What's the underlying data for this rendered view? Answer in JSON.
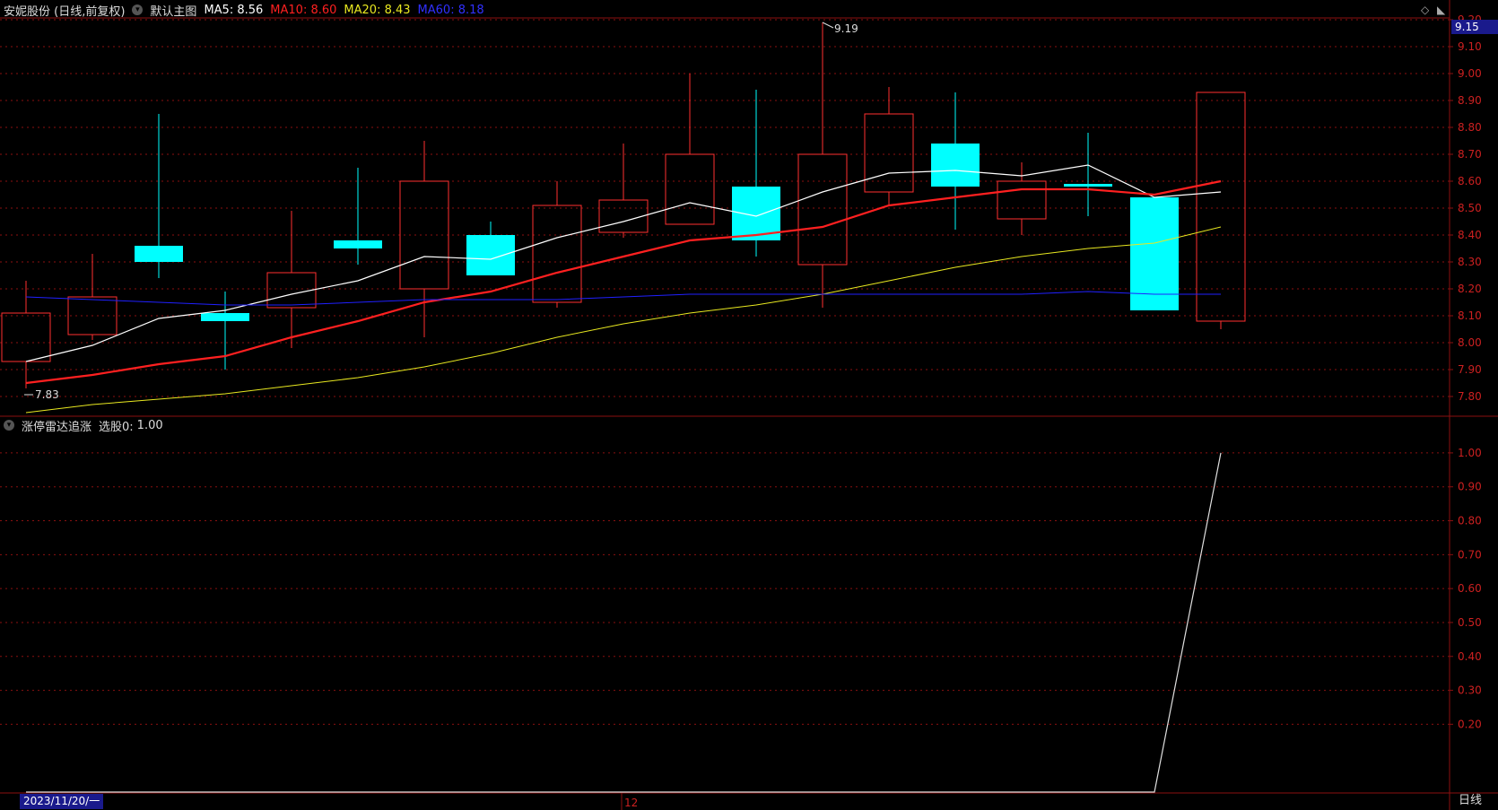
{
  "header": {
    "stock": "安妮股份 (日线,前复权)",
    "template_label": "默认主图",
    "ma5": {
      "label": "MA5:",
      "value": "8.56",
      "color": "#ffffff"
    },
    "ma10": {
      "label": "MA10:",
      "value": "8.60",
      "color": "#ff2020"
    },
    "ma20": {
      "label": "MA20:",
      "value": "8.43",
      "color": "#e8e820"
    },
    "ma60": {
      "label": "MA60:",
      "value": "8.18",
      "color": "#2020ff"
    }
  },
  "indicator_header": {
    "name": "涨停雷达追涨",
    "label": "选股0:",
    "value": "1.00"
  },
  "price_tag": "9.15",
  "axis_date": "2023/11/20/一",
  "month_label": "12",
  "timeframe": "日线",
  "annotations": {
    "high": "9.19",
    "low": "7.83"
  },
  "chart_data": [
    {
      "type": "candlestick",
      "colors": {
        "up": "#ff3030",
        "down": "#00ffff"
      },
      "ylim": [
        7.73,
        9.2
      ],
      "y_ticks": [
        "7.80",
        "7.90",
        "8.00",
        "8.10",
        "8.20",
        "8.30",
        "8.40",
        "8.50",
        "8.60",
        "8.70",
        "8.80",
        "8.90",
        "9.00",
        "9.10",
        "9.20"
      ],
      "candles": [
        {
          "o": 7.93,
          "h": 8.23,
          "l": 7.83,
          "c": 8.11
        },
        {
          "o": 8.03,
          "h": 8.33,
          "l": 8.01,
          "c": 8.17
        },
        {
          "o": 8.36,
          "h": 8.85,
          "l": 8.24,
          "c": 8.3
        },
        {
          "o": 8.11,
          "h": 8.19,
          "l": 7.9,
          "c": 8.08
        },
        {
          "o": 8.13,
          "h": 8.49,
          "l": 7.98,
          "c": 8.26
        },
        {
          "o": 8.38,
          "h": 8.65,
          "l": 8.29,
          "c": 8.35
        },
        {
          "o": 8.2,
          "h": 8.75,
          "l": 8.02,
          "c": 8.6
        },
        {
          "o": 8.4,
          "h": 8.45,
          "l": 8.25,
          "c": 8.25
        },
        {
          "o": 8.15,
          "h": 8.6,
          "l": 8.13,
          "c": 8.51
        },
        {
          "o": 8.41,
          "h": 8.74,
          "l": 8.39,
          "c": 8.53
        },
        {
          "o": 8.44,
          "h": 9.0,
          "l": 8.44,
          "c": 8.7
        },
        {
          "o": 8.58,
          "h": 8.94,
          "l": 8.32,
          "c": 8.38
        },
        {
          "o": 8.29,
          "h": 9.19,
          "l": 8.13,
          "c": 8.7
        },
        {
          "o": 8.56,
          "h": 8.95,
          "l": 8.51,
          "c": 8.85
        },
        {
          "o": 8.74,
          "h": 8.93,
          "l": 8.42,
          "c": 8.58
        },
        {
          "o": 8.46,
          "h": 8.67,
          "l": 8.4,
          "c": 8.6
        },
        {
          "o": 8.59,
          "h": 8.78,
          "l": 8.47,
          "c": 8.58
        },
        {
          "o": 8.54,
          "h": 8.54,
          "l": 8.12,
          "c": 8.12
        },
        {
          "o": 8.08,
          "h": 8.93,
          "l": 8.05,
          "c": 8.93
        }
      ],
      "series": [
        {
          "name": "MA5",
          "color": "#ffffff",
          "width": 1.2,
          "values": [
            7.93,
            7.99,
            8.09,
            8.12,
            8.18,
            8.23,
            8.32,
            8.31,
            8.39,
            8.45,
            8.52,
            8.47,
            8.56,
            8.63,
            8.64,
            8.62,
            8.66,
            8.54,
            8.56
          ]
        },
        {
          "name": "MA10",
          "color": "#ff2020",
          "width": 2.2,
          "values": [
            7.85,
            7.88,
            7.92,
            7.95,
            8.02,
            8.08,
            8.15,
            8.19,
            8.26,
            8.32,
            8.38,
            8.4,
            8.43,
            8.51,
            8.54,
            8.57,
            8.57,
            8.55,
            8.6
          ]
        },
        {
          "name": "MA20",
          "color": "#e8e820",
          "width": 1,
          "values": [
            7.74,
            7.77,
            7.79,
            7.81,
            7.84,
            7.87,
            7.91,
            7.96,
            8.02,
            8.07,
            8.11,
            8.14,
            8.18,
            8.23,
            8.28,
            8.32,
            8.35,
            8.37,
            8.43
          ]
        },
        {
          "name": "MA60",
          "color": "#2020ff",
          "width": 1,
          "values": [
            8.17,
            8.16,
            8.15,
            8.14,
            8.14,
            8.15,
            8.16,
            8.16,
            8.16,
            8.17,
            8.18,
            8.18,
            8.18,
            8.18,
            8.18,
            8.18,
            8.19,
            8.18,
            8.18
          ]
        }
      ]
    },
    {
      "type": "line",
      "ylim": [
        0,
        1.05
      ],
      "y_ticks": [
        "0.20",
        "0.30",
        "0.40",
        "0.50",
        "0.60",
        "0.70",
        "0.80",
        "0.90",
        "1.00"
      ],
      "series": [
        {
          "name": "选股0",
          "color": "#e0e0e0",
          "values": [
            0,
            0,
            0,
            0,
            0,
            0,
            0,
            0,
            0,
            0,
            0,
            0,
            0,
            0,
            0,
            0,
            0,
            0,
            1.0
          ]
        }
      ]
    }
  ]
}
